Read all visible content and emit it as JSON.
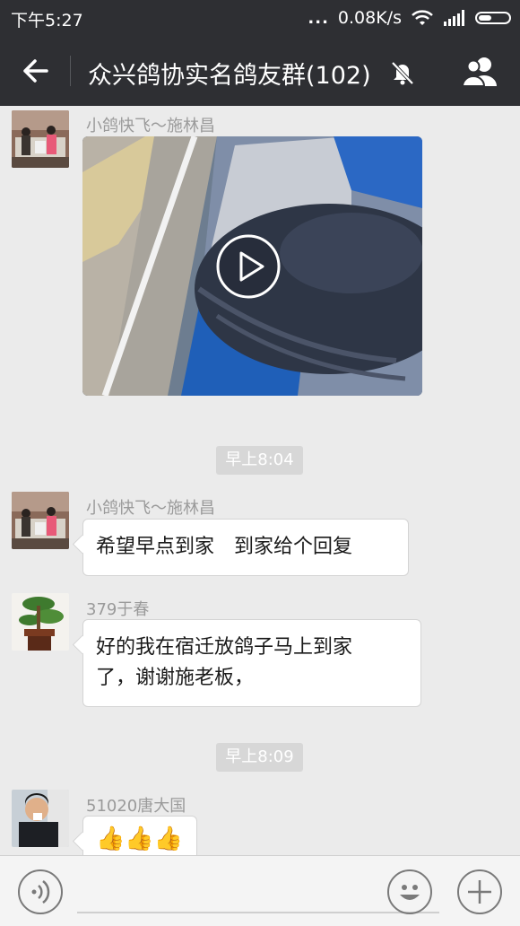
{
  "status_bar": {
    "time": "下午5:27",
    "dots": "...",
    "network_speed": "0.08K/s"
  },
  "header": {
    "title": "众兴鸽协实名鸽友群(102)",
    "icons": [
      "back-arrow-icon",
      "mute-bell-icon",
      "group-members-icon"
    ]
  },
  "messages": [
    {
      "sender": "小鸽快飞～施林昌",
      "type": "video"
    },
    {
      "type": "time",
      "text": "早上8:04"
    },
    {
      "sender": "小鸽快飞～施林昌",
      "type": "text",
      "text": "希望早点到家　到家给个回复"
    },
    {
      "sender": "379于春",
      "type": "text",
      "lines": [
        "好的我在宿迁放鸽子马上到家",
        "了，谢谢施老板，"
      ]
    },
    {
      "type": "time",
      "text": "早上8:09"
    },
    {
      "sender": "51020唐大国",
      "type": "emoji",
      "emoji": "👍👍👍"
    }
  ],
  "input_bar": {
    "icons": [
      "voice-icon",
      "emoji-icon",
      "plus-icon"
    ],
    "value": ""
  },
  "colors": {
    "bar": "#2e2f33",
    "background": "#ebebeb",
    "bubble": "#ffffff"
  }
}
